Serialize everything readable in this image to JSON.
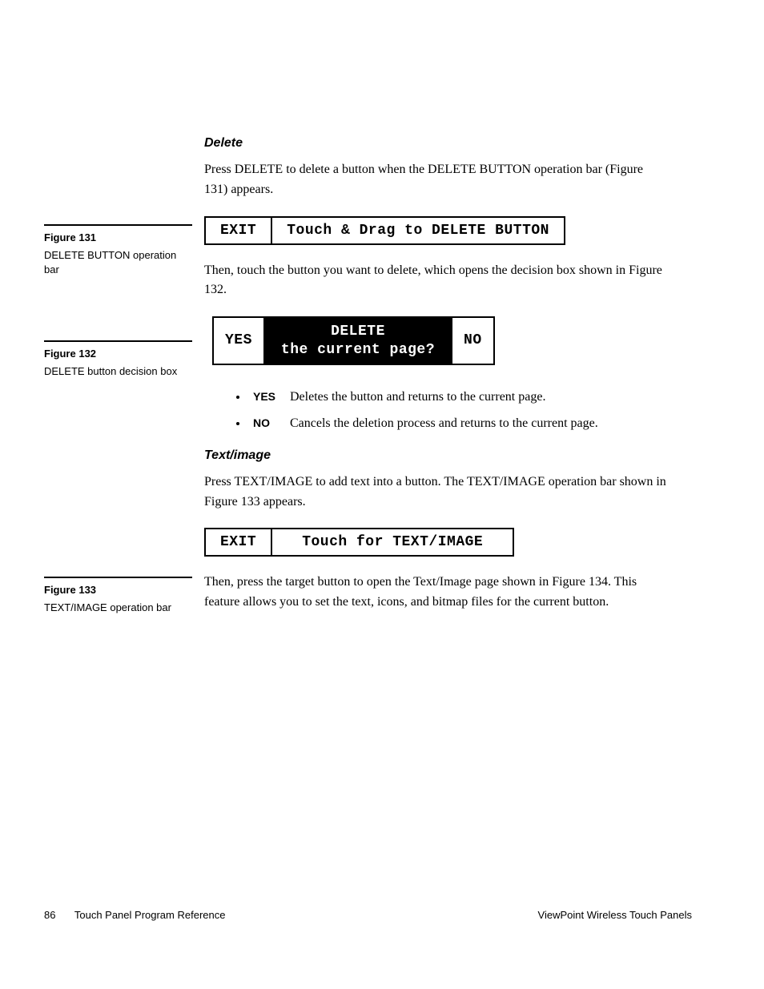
{
  "sections": {
    "delete": {
      "heading": "Delete",
      "para1": "Press DELETE to delete a button when the DELETE BUTTON operation bar (Figure 131) appears.",
      "para2": "Then, touch the button you want to delete, which opens the decision box shown in Figure 132."
    },
    "textimage": {
      "heading": "Text/image",
      "para1": "Press TEXT/IMAGE to add text into a button. The TEXT/IMAGE operation bar shown in Figure 133 appears.",
      "para2": "Then, press the target button to open the Text/Image page shown in Figure 134. This feature allows you to set the text, icons, and bitmap files for the current button."
    }
  },
  "figures": {
    "f131": {
      "label": "Figure 131",
      "caption": "DELETE BUTTON operation bar"
    },
    "f132": {
      "label": "Figure 132",
      "caption": "DELETE button decision box"
    },
    "f133": {
      "label": "Figure 133",
      "caption": "TEXT/IMAGE operation bar"
    }
  },
  "opbar131": {
    "exit": "EXIT",
    "msg": "Touch & Drag to DELETE BUTTON"
  },
  "decision132": {
    "yes": "YES",
    "line1": "DELETE",
    "line2": "the current page?",
    "no": "NO"
  },
  "bullets": {
    "yes_label": "YES",
    "yes_text": "Deletes the button and returns to the current page.",
    "no_label": "NO",
    "no_text": "Cancels the deletion process and returns to the current page."
  },
  "opbar133": {
    "exit": "EXIT",
    "msg": "Touch for TEXT/IMAGE"
  },
  "footer": {
    "page": "86",
    "left": "Touch Panel Program Reference",
    "right": "ViewPoint Wireless Touch Panels"
  }
}
